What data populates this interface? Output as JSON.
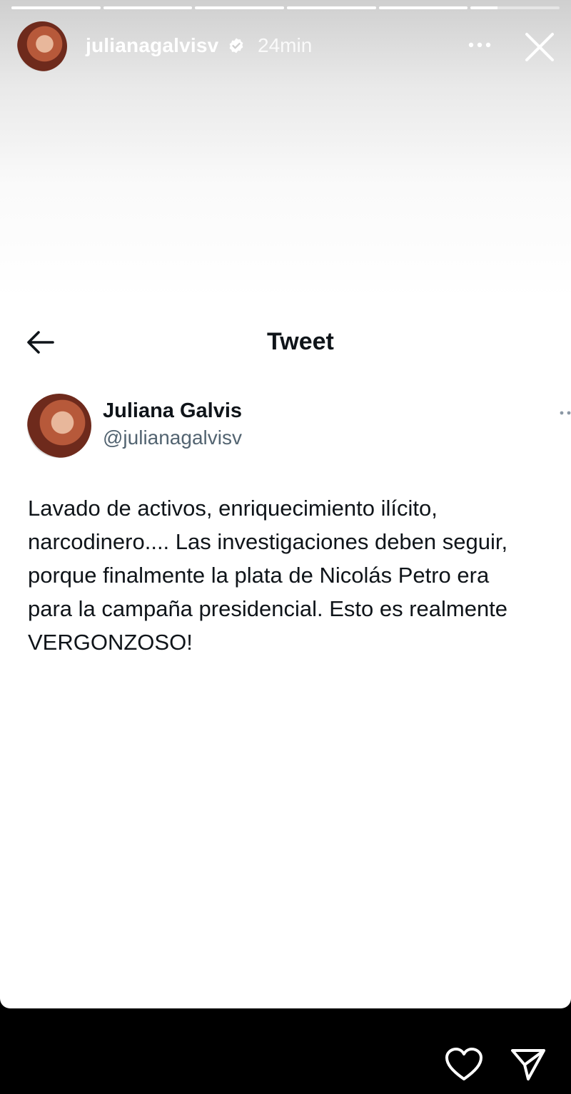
{
  "story": {
    "progress": [
      1,
      1,
      1,
      1,
      1,
      0.3
    ],
    "username": "julianagalvisv",
    "time": "24min",
    "icons": {
      "avatar": "profile-photo",
      "verified": "verified-badge-icon",
      "more": "more-horizontal-icon",
      "close": "close-icon"
    }
  },
  "tweet": {
    "page_title": "Tweet",
    "name": "Juliana Galvis",
    "handle": "@julianagalvisv",
    "text": "Lavado de activos, enriquecimiento ilícito,\nnarcodinero.... Las investigaciones deben seguir,\nporque finalmente la plata de Nicolás Petro era\npara la campaña presidencial. Esto es realmente\nVERGONZOSO!",
    "icons": {
      "back": "back-arrow-icon",
      "more": "more-horizontal-icon"
    }
  },
  "bottom_bar": {
    "icons": {
      "like": "heart-icon",
      "share": "send-icon"
    }
  },
  "colors": {
    "text_primary": "#0f1419",
    "text_secondary": "#536471",
    "background_bottom": "#000000"
  }
}
